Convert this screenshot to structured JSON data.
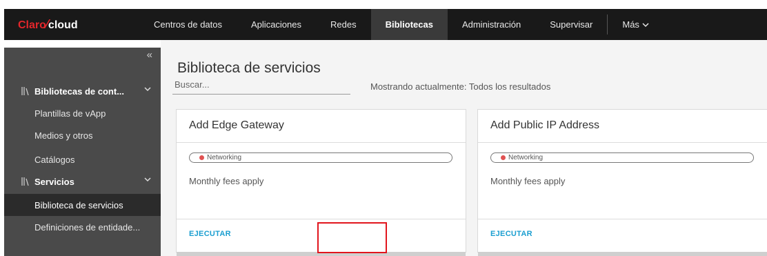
{
  "brand": {
    "claro": "Claro",
    "cloud": "cloud"
  },
  "nav": {
    "items": [
      {
        "label": "Centros de datos"
      },
      {
        "label": "Aplicaciones"
      },
      {
        "label": "Redes"
      },
      {
        "label": "Bibliotecas",
        "active": true
      },
      {
        "label": "Administración"
      },
      {
        "label": "Supervisar"
      }
    ],
    "more_label": "Más"
  },
  "sidebar": {
    "collapse_label": "«",
    "groups": [
      {
        "label": "Bibliotecas de cont...",
        "items": [
          "Plantillas de vApp",
          "Medios y otros",
          "Catálogos"
        ]
      },
      {
        "label": "Servicios",
        "items": [
          "Biblioteca de servicios",
          "Definiciones de entidade..."
        ]
      }
    ],
    "selected": "Biblioteca de servicios"
  },
  "main": {
    "title": "Biblioteca de servicios",
    "search_placeholder": "Buscar...",
    "showing_text": "Mostrando actualmente: Todos los resultados",
    "cards": [
      {
        "title": "Add Edge Gateway",
        "tag": "Networking",
        "description": "Monthly fees apply",
        "action": "EJECUTAR"
      },
      {
        "title": "Add Public IP Address",
        "tag": "Networking",
        "description": "Monthly fees apply",
        "action": "EJECUTAR"
      }
    ]
  },
  "colors": {
    "brand_red": "#e3262b",
    "topbar": "#191919",
    "sidebar": "#4a4a4a",
    "accent": "#1a9ed0",
    "highlight": "#e1141c"
  }
}
